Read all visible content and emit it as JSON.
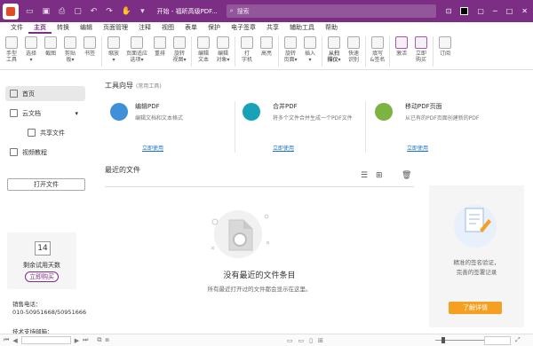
{
  "titlebar": {
    "title": "开始 - 福昕高级PDF...",
    "search_placeholder": "搜索"
  },
  "menu": [
    "文件",
    "主页",
    "转换",
    "编辑",
    "页面管理",
    "注释",
    "视图",
    "表单",
    "保护",
    "电子签章",
    "共享",
    "辅助工具",
    "帮助"
  ],
  "ribbon": [
    {
      "label": "手型\n工具",
      "name": "hand-tool"
    },
    {
      "label": "选择\n▾",
      "name": "select"
    },
    {
      "label": "截图",
      "name": "snapshot"
    },
    {
      "label": "剪贴\n板▾",
      "name": "clipboard"
    },
    {
      "label": "书签",
      "name": "bookmark"
    },
    {
      "label": "缩放\n▾",
      "name": "zoom"
    },
    {
      "label": "页面适应\n选项▾",
      "name": "fit-page"
    },
    {
      "label": "重排",
      "name": "reflow"
    },
    {
      "label": "旋转\n视图▾",
      "name": "rotate-view"
    },
    {
      "label": "编辑\n文本",
      "name": "edit-text"
    },
    {
      "label": "编辑\n对象▾",
      "name": "edit-object"
    },
    {
      "label": "打\n字机",
      "name": "typewriter"
    },
    {
      "label": "高亮",
      "name": "highlight"
    },
    {
      "label": "旋转\n页面▾",
      "name": "rotate-page"
    },
    {
      "label": "插入\n▾",
      "name": "insert"
    },
    {
      "label": "从扫\n描仪▾",
      "name": "from-scanner"
    },
    {
      "label": "快速\n识别",
      "name": "quick-ocr"
    },
    {
      "label": "填写\n&签名",
      "name": "fill-sign"
    },
    {
      "label": "激活",
      "name": "activate"
    },
    {
      "label": "立即\n购买",
      "name": "buy-now"
    },
    {
      "label": "订阅",
      "name": "subscribe"
    }
  ],
  "sidebar": {
    "items": [
      {
        "label": "首页",
        "icon": "home-icon"
      },
      {
        "label": "云文档",
        "icon": "cloud-icon"
      },
      {
        "label": "共享文件",
        "icon": "share-icon"
      },
      {
        "label": "视频教程",
        "icon": "video-icon"
      }
    ],
    "open_file": "打开文件",
    "trial_days": "14",
    "trial_text": "剩余试用天数",
    "buy_label": "立即购买",
    "sales_label": "销售电话：",
    "sales_number": "010-50951668/50951666",
    "support_label": "技术支持邮箱："
  },
  "tool_guide": {
    "title": "工具向导",
    "subtitle": "(常用工具)",
    "cards": [
      {
        "title": "编辑PDF",
        "desc": "编辑文档和文本格式",
        "link": "立即使用",
        "color": "#3f8fd9"
      },
      {
        "title": "合并PDF",
        "desc": "将多个文件合并生成一个PDF文件",
        "link": "立即使用",
        "color": "#17a2b8"
      },
      {
        "title": "移动PDF页面",
        "desc": "从已有的PDF页面创建新的PDF",
        "link": "立即使用",
        "color": "#7cb342"
      }
    ]
  },
  "recent": {
    "title": "最近的文件",
    "empty_title": "没有最近的文件条目",
    "empty_desc": "所有最近打开过的文件都会显示在这里。"
  },
  "promo": {
    "line1": "精准的签名验证，",
    "line2": "完善的签署记录",
    "button": "了解详情"
  }
}
